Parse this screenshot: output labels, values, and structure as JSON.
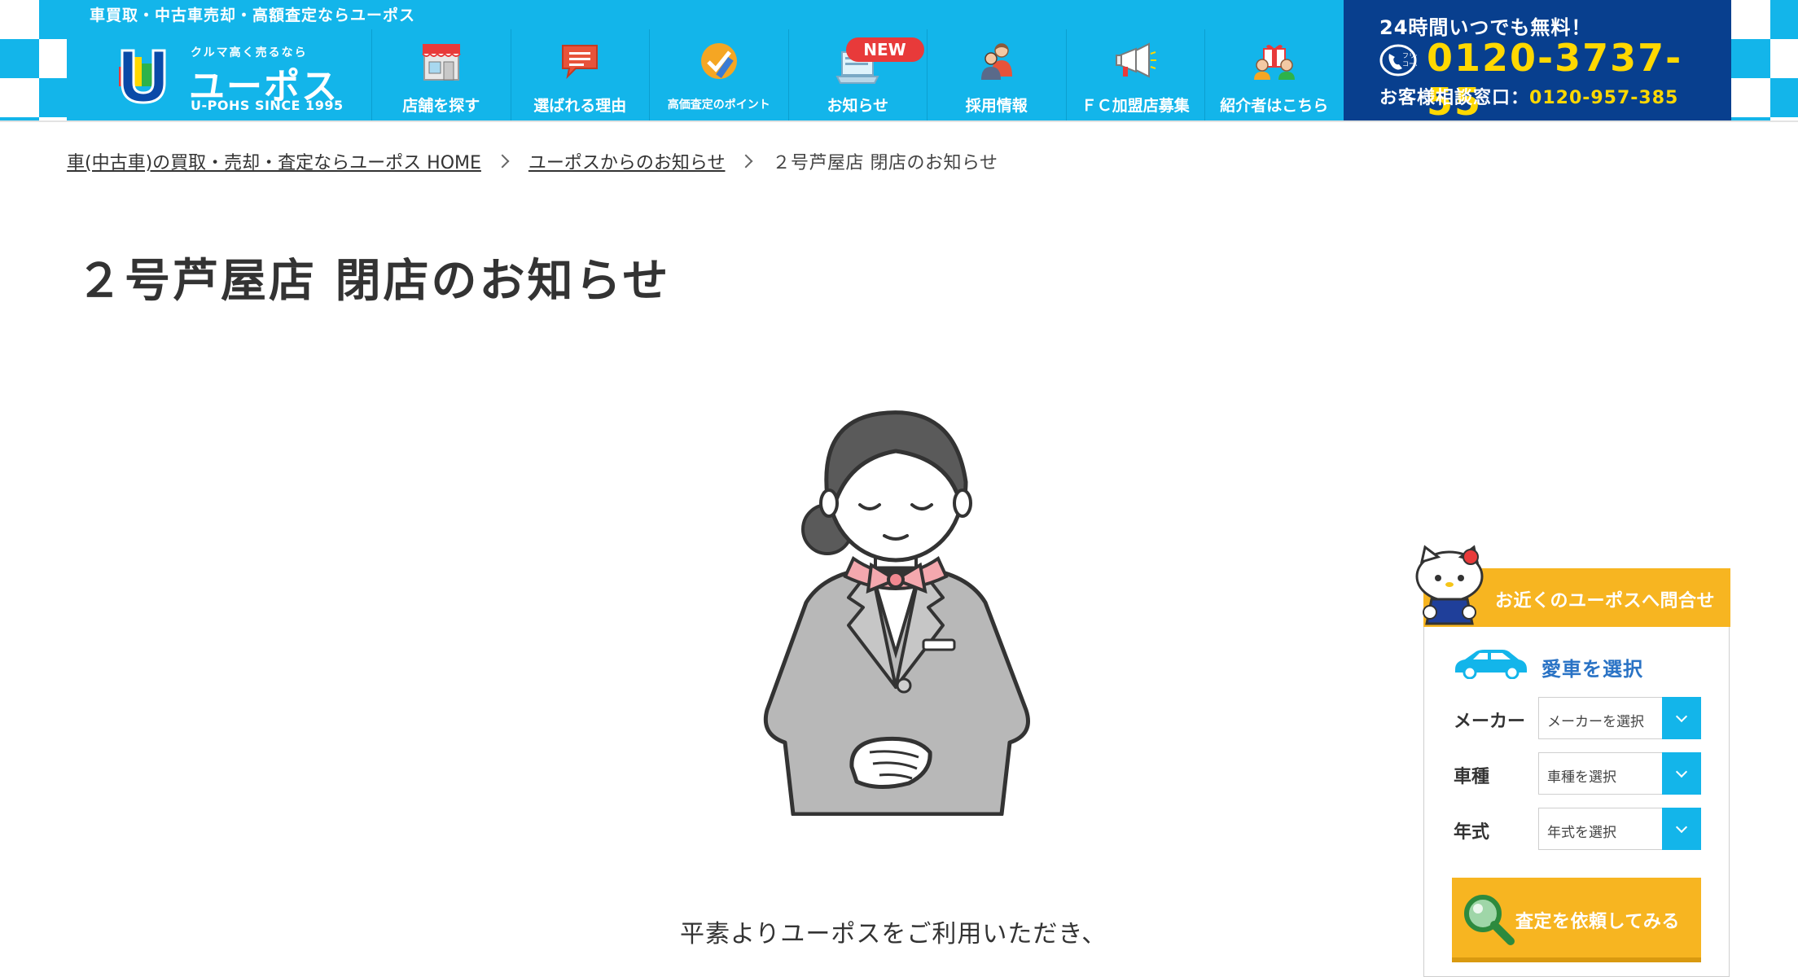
{
  "header": {
    "tagline": "車買取・中古車売却・高額査定ならユーポス",
    "logo": {
      "sub": "クルマ高く売るなら",
      "name": "ユーポス",
      "since": "U-POHS SINCE 1995"
    },
    "nav": [
      {
        "label": "店舗を探す",
        "icon": "store-icon"
      },
      {
        "label": "選ばれる理由",
        "icon": "speech-bubble-icon"
      },
      {
        "label": "高価査定のポイント",
        "icon": "check-pencil-icon"
      },
      {
        "label": "お知らせ",
        "icon": "laptop-icon",
        "badge": "NEW"
      },
      {
        "label": "採用情報",
        "icon": "people-icon"
      },
      {
        "label": "ＦＣ加盟店募集",
        "icon": "megaphone-icon"
      },
      {
        "label": "紹介者はこちら",
        "icon": "gift-icon"
      }
    ],
    "call": {
      "top": "24時間いつでも無料！",
      "free_label": "フリーコール",
      "number": "0120-3737-55",
      "sub_label": "お客様相談窓口：",
      "sub_number": "0120-957-385"
    }
  },
  "breadcrumb": {
    "home": "車(中古車)の買取・売却・査定ならユーポス HOME",
    "news": "ユーポスからのお知らせ",
    "current": "２号芦屋店 閉店のお知らせ"
  },
  "page_title": "２号芦屋店 閉店のお知らせ",
  "body_text": "平素よりユーポスをご利用いただき、",
  "side": {
    "head": "お近くのユーポスへ問合せ",
    "subtitle": "愛車を選択",
    "fields": [
      {
        "label": "メーカー",
        "placeholder": "メーカーを選択"
      },
      {
        "label": "車種",
        "placeholder": "車種を選択"
      },
      {
        "label": "年式",
        "placeholder": "年式を選択"
      }
    ],
    "cta": "査定を依頼してみる"
  },
  "colors": {
    "brand_blue": "#13b5ea",
    "navy": "#083f8e",
    "phone_yellow": "#ffd800",
    "widget_orange": "#f7b521",
    "badge_red": "#e83a3a"
  }
}
